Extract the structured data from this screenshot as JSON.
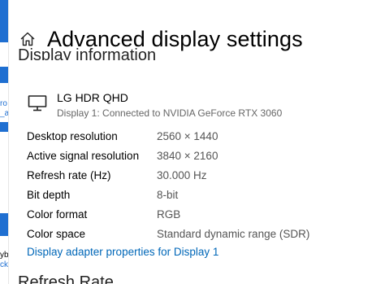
{
  "desktop_fragments": [
    "ro",
    "_a",
    "yb",
    "ck"
  ],
  "header": {
    "home_icon": "home-icon",
    "title": "Advanced display settings"
  },
  "section": {
    "title": "Display information"
  },
  "monitor": {
    "icon": "monitor-icon",
    "name": "LG HDR QHD",
    "subtitle": "Display 1: Connected to NVIDIA GeForce RTX 3060"
  },
  "info_rows": [
    {
      "label": "Desktop resolution",
      "value": "2560 × 1440"
    },
    {
      "label": "Active signal resolution",
      "value": "3840 × 2160"
    },
    {
      "label": "Refresh rate (Hz)",
      "value": "30.000 Hz"
    },
    {
      "label": "Bit depth",
      "value": "8-bit"
    },
    {
      "label": "Color format",
      "value": "RGB"
    },
    {
      "label": "Color space",
      "value": "Standard dynamic range (SDR)"
    }
  ],
  "adapter_link": "Display adapter properties for Display 1",
  "next_section": {
    "title": "Refresh Rate"
  },
  "colors": {
    "accent": "#0067b8",
    "desktop_blue": "#1f6fd1"
  }
}
